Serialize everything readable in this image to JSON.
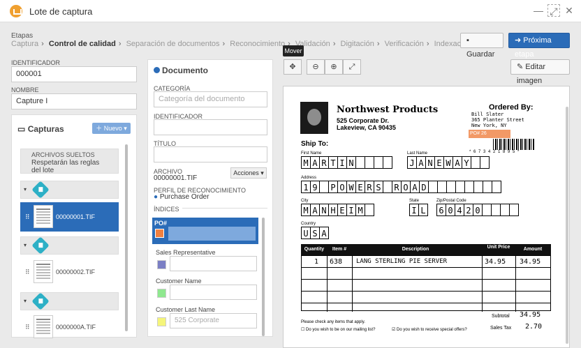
{
  "window": {
    "title": "Lote de captura"
  },
  "breadcrumb": {
    "label": "Etapas",
    "steps": [
      "Captura",
      "Control de calidad",
      "Separación de documentos",
      "Reconocimiento",
      "Validación",
      "Digitación",
      "Verificación",
      "Indexación"
    ],
    "active_index": 1
  },
  "toolbar": {
    "save_label": "Guardar",
    "next_label": "Próxima etapa",
    "edit_image_label": "Editar imagen",
    "move_tooltip": "Mover"
  },
  "batch": {
    "identifier_label": "IDENTIFICADOR",
    "identifier_value": "000001",
    "name_label": "NOMBRE",
    "name_value": "Capture I"
  },
  "captures": {
    "title": "Capturas",
    "new_label": "Nuevo",
    "loose_title": "ARCHIVOS SUELTOS",
    "loose_text": "Respetarán las reglas del lote",
    "files": [
      "00000001.TIF",
      "00000002.TIF",
      "0000000A.TIF"
    ]
  },
  "document": {
    "title": "Documento",
    "category_label": "CATEGORÍA",
    "category_placeholder": "Categoría del documento",
    "identifier_label": "IDENTIFICADOR",
    "title_label": "TÍTULO",
    "file_label": "ARCHIVO",
    "file_value": "00000001.TIF",
    "actions_label": "Acciones",
    "profile_label": "PERFIL DE RECONOCIMIENTO",
    "profile_value": "Purchase Order",
    "indices_label": "ÍNDICES",
    "indices": [
      {
        "name": "PO#",
        "color": "#f08040",
        "value": ""
      },
      {
        "name": "Sales Representative",
        "color": "#7b7fc4",
        "value": ""
      },
      {
        "name": "Customer Name",
        "color": "#8fe88f",
        "value": ""
      },
      {
        "name": "Customer Last Name",
        "color": "#f5f57a",
        "value": "525 Corporate"
      }
    ]
  },
  "scan": {
    "company": "Northwest Products",
    "address1": "525 Corporate Dr.",
    "address2": "Lakeview, CA  90435",
    "ordered_by": "Ordered By:",
    "orderer_lines": [
      "Bill Slater",
      "365 Planter Street",
      "New York, NY"
    ],
    "po_text": "PO# 26",
    "barcode_number": "* 6 7 3 4 2 1 8 9 5 *",
    "ship_to": "Ship To:",
    "first_name_label": "First Name",
    "first_name": "MARTIN",
    "last_name_label": "Last Name",
    "last_name": "JANEWAY",
    "address_label": "Address",
    "address": "19 POWERS ROAD",
    "city_label": "City",
    "city": "MANHEIM",
    "state_label": "State",
    "state": "IL",
    "zip_label": "Zip/Postal Code",
    "zip": "60420",
    "country_label": "Country",
    "country": "USA",
    "table_headers": [
      "Quantity",
      "Item #",
      "Description",
      "Unit Price",
      "Amount"
    ],
    "row1": {
      "qty": "1",
      "item": "638",
      "desc": "LANG STERLING PIE SERVER",
      "price": "34.95",
      "amount": "34.95"
    },
    "check_note": "Please check any items that apply.",
    "check1": "Do you wish to be on our mailing list?",
    "check2": "Do you wish to receive special offers?",
    "subtotal_label": "Subtotal",
    "subtotal": "34.95",
    "tax_label": "Sales Tax",
    "tax": "2.70"
  }
}
